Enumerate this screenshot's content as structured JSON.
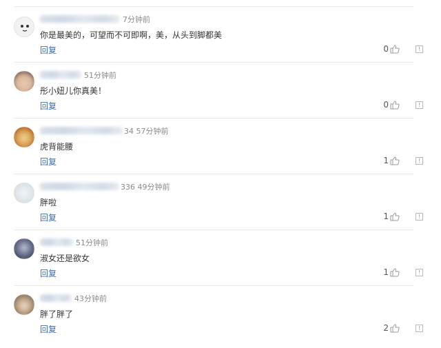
{
  "comments": [
    {
      "time": "7分钟前",
      "text": "你是最美的，可望而不可即啊，美，从头到脚都美",
      "reply_label": "回复",
      "likes": "0",
      "avatar_color": "#f2f2f2"
    },
    {
      "time": "51分钟前",
      "text": "彤小妞儿你真美！",
      "reply_label": "回复",
      "likes": "0",
      "avatar_color": "#d9b79d"
    },
    {
      "time": "34 57分钟前",
      "text": "虎背能腰",
      "reply_label": "回复",
      "likes": "1",
      "avatar_color": "#d7a35a"
    },
    {
      "time": "336 49分钟前",
      "text": "胖啦",
      "reply_label": "回复",
      "likes": "1",
      "avatar_color": "#dfe5e9"
    },
    {
      "time": "51分钟前",
      "text": "淑女还是欲女",
      "reply_label": "回复",
      "likes": "1",
      "avatar_color": "#6e7590"
    },
    {
      "time": "43分钟前",
      "text": "胖了胖了",
      "reply_label": "回复",
      "likes": "2",
      "avatar_color": "#8c7a66"
    }
  ],
  "colors": {
    "link": "#3b6db3",
    "divider": "#ebebeb",
    "meta": "#8a8a8a"
  },
  "icons": {
    "like": "thumbs-up-icon",
    "report": "report-icon"
  }
}
